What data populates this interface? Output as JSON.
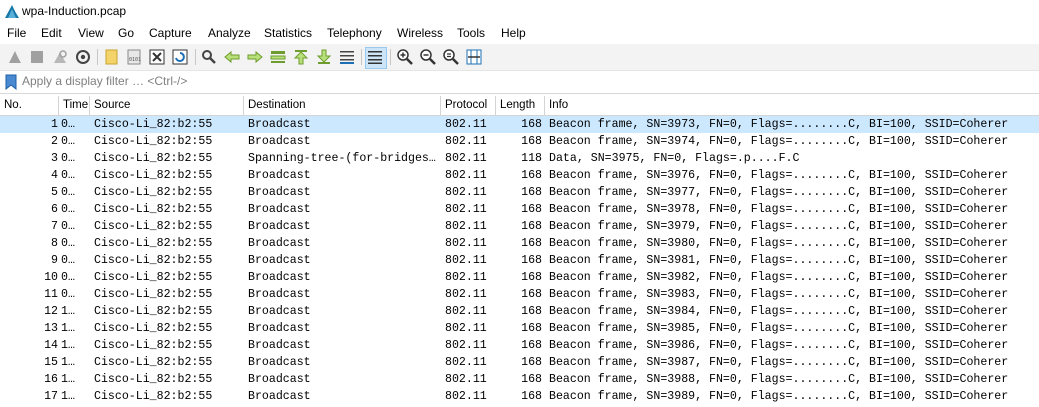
{
  "window": {
    "title": "wpa-Induction.pcap",
    "icon": "wireshark-fin-icon"
  },
  "menu": [
    "File",
    "Edit",
    "View",
    "Go",
    "Capture",
    "Analyze",
    "Statistics",
    "Telephony",
    "Wireless",
    "Tools",
    "Help"
  ],
  "toolbar": {
    "buttons": [
      "start-capture-icon",
      "stop-capture-icon",
      "restart-capture-icon",
      "capture-options-icon",
      "open-file-icon",
      "save-file-icon",
      "close-file-icon",
      "reload-file-icon",
      "find-packet-icon",
      "go-back-icon",
      "go-forward-icon",
      "go-to-packet-icon",
      "go-first-icon",
      "go-last-icon",
      "auto-scroll-icon",
      "colorize-icon",
      "zoom-in-icon",
      "zoom-out-icon",
      "zoom-normal-icon",
      "resize-columns-icon"
    ]
  },
  "filter": {
    "placeholder": "Apply a display filter … <Ctrl-/>"
  },
  "columns": {
    "no": "No.",
    "time": "Time",
    "source": "Source",
    "destination": "Destination",
    "protocol": "Protocol",
    "length": "Length",
    "info": "Info"
  },
  "packets": [
    {
      "no": "1",
      "time": "0…",
      "source": "Cisco-Li_82:b2:55",
      "destination": "Broadcast",
      "protocol": "802.11",
      "length": "168",
      "info": "Beacon frame, SN=3973, FN=0, Flags=........C, BI=100, SSID=Coherer"
    },
    {
      "no": "2",
      "time": "0…",
      "source": "Cisco-Li_82:b2:55",
      "destination": "Broadcast",
      "protocol": "802.11",
      "length": "168",
      "info": "Beacon frame, SN=3974, FN=0, Flags=........C, BI=100, SSID=Coherer"
    },
    {
      "no": "3",
      "time": "0…",
      "source": "Cisco-Li_82:b2:55",
      "destination": "Spanning-tree-(for-bridges…",
      "protocol": "802.11",
      "length": "118",
      "info": "Data, SN=3975, FN=0, Flags=.p....F.C"
    },
    {
      "no": "4",
      "time": "0…",
      "source": "Cisco-Li_82:b2:55",
      "destination": "Broadcast",
      "protocol": "802.11",
      "length": "168",
      "info": "Beacon frame, SN=3976, FN=0, Flags=........C, BI=100, SSID=Coherer"
    },
    {
      "no": "5",
      "time": "0…",
      "source": "Cisco-Li_82:b2:55",
      "destination": "Broadcast",
      "protocol": "802.11",
      "length": "168",
      "info": "Beacon frame, SN=3977, FN=0, Flags=........C, BI=100, SSID=Coherer"
    },
    {
      "no": "6",
      "time": "0…",
      "source": "Cisco-Li_82:b2:55",
      "destination": "Broadcast",
      "protocol": "802.11",
      "length": "168",
      "info": "Beacon frame, SN=3978, FN=0, Flags=........C, BI=100, SSID=Coherer"
    },
    {
      "no": "7",
      "time": "0…",
      "source": "Cisco-Li_82:b2:55",
      "destination": "Broadcast",
      "protocol": "802.11",
      "length": "168",
      "info": "Beacon frame, SN=3979, FN=0, Flags=........C, BI=100, SSID=Coherer"
    },
    {
      "no": "8",
      "time": "0…",
      "source": "Cisco-Li_82:b2:55",
      "destination": "Broadcast",
      "protocol": "802.11",
      "length": "168",
      "info": "Beacon frame, SN=3980, FN=0, Flags=........C, BI=100, SSID=Coherer"
    },
    {
      "no": "9",
      "time": "0…",
      "source": "Cisco-Li_82:b2:55",
      "destination": "Broadcast",
      "protocol": "802.11",
      "length": "168",
      "info": "Beacon frame, SN=3981, FN=0, Flags=........C, BI=100, SSID=Coherer"
    },
    {
      "no": "10",
      "time": "0…",
      "source": "Cisco-Li_82:b2:55",
      "destination": "Broadcast",
      "protocol": "802.11",
      "length": "168",
      "info": "Beacon frame, SN=3982, FN=0, Flags=........C, BI=100, SSID=Coherer"
    },
    {
      "no": "11",
      "time": "0…",
      "source": "Cisco-Li_82:b2:55",
      "destination": "Broadcast",
      "protocol": "802.11",
      "length": "168",
      "info": "Beacon frame, SN=3983, FN=0, Flags=........C, BI=100, SSID=Coherer"
    },
    {
      "no": "12",
      "time": "1…",
      "source": "Cisco-Li_82:b2:55",
      "destination": "Broadcast",
      "protocol": "802.11",
      "length": "168",
      "info": "Beacon frame, SN=3984, FN=0, Flags=........C, BI=100, SSID=Coherer"
    },
    {
      "no": "13",
      "time": "1…",
      "source": "Cisco-Li_82:b2:55",
      "destination": "Broadcast",
      "protocol": "802.11",
      "length": "168",
      "info": "Beacon frame, SN=3985, FN=0, Flags=........C, BI=100, SSID=Coherer"
    },
    {
      "no": "14",
      "time": "1…",
      "source": "Cisco-Li_82:b2:55",
      "destination": "Broadcast",
      "protocol": "802.11",
      "length": "168",
      "info": "Beacon frame, SN=3986, FN=0, Flags=........C, BI=100, SSID=Coherer"
    },
    {
      "no": "15",
      "time": "1…",
      "source": "Cisco-Li_82:b2:55",
      "destination": "Broadcast",
      "protocol": "802.11",
      "length": "168",
      "info": "Beacon frame, SN=3987, FN=0, Flags=........C, BI=100, SSID=Coherer"
    },
    {
      "no": "16",
      "time": "1…",
      "source": "Cisco-Li_82:b2:55",
      "destination": "Broadcast",
      "protocol": "802.11",
      "length": "168",
      "info": "Beacon frame, SN=3988, FN=0, Flags=........C, BI=100, SSID=Coherer"
    },
    {
      "no": "17",
      "time": "1…",
      "source": "Cisco-Li_82:b2:55",
      "destination": "Broadcast",
      "protocol": "802.11",
      "length": "168",
      "info": "Beacon frame, SN=3989, FN=0, Flags=........C, BI=100, SSID=Coherer"
    }
  ],
  "selected_row": 0,
  "colors": {
    "selection": "#cce8ff",
    "toolbar_bg": "#f3f3f3",
    "active_button": "#cce4f7"
  }
}
